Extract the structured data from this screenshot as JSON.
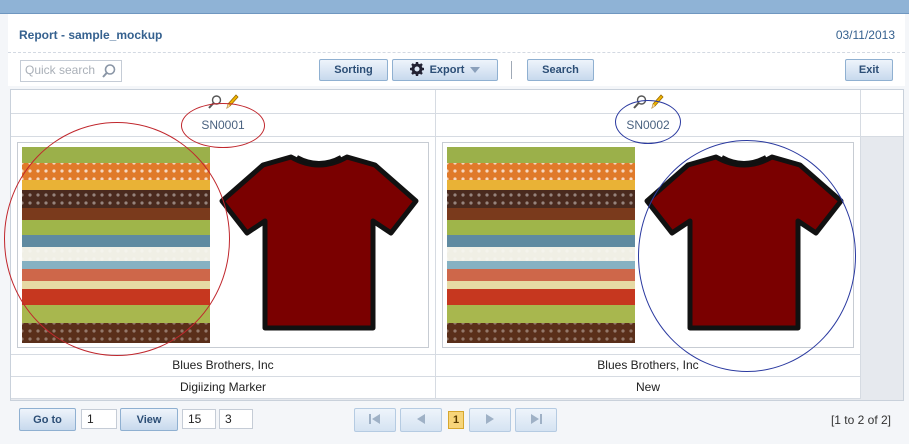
{
  "header": {
    "title": "Report - sample_mockup",
    "date": "03/11/2013"
  },
  "toolbar": {
    "search_placeholder": "Quick search",
    "sorting_label": "Sorting",
    "export_label": "Export",
    "search_label": "Search",
    "exit_label": "Exit"
  },
  "records": [
    {
      "sn": "SN0001",
      "company": "Blues Brothers, Inc",
      "status": "Digiizing Marker"
    },
    {
      "sn": "SN0002",
      "company": "Blues Brothers, Inc",
      "status": "New"
    }
  ],
  "pager": {
    "goto_label": "Go to",
    "goto_value": "1",
    "view_label": "View",
    "view_value": "15",
    "view_value2": "3",
    "current_page": "1",
    "range": "[1 to 2 of 2]"
  },
  "colors": {
    "shirt": "#7a0000",
    "annotation_red": "#c0272d",
    "annotation_blue": "#2b3aa0"
  },
  "icons": [
    "search-icon",
    "gear-icon",
    "chevron-down-icon",
    "zoom-icon",
    "pencil-icon",
    "first-page-icon",
    "prev-page-icon",
    "next-page-icon",
    "last-page-icon"
  ]
}
